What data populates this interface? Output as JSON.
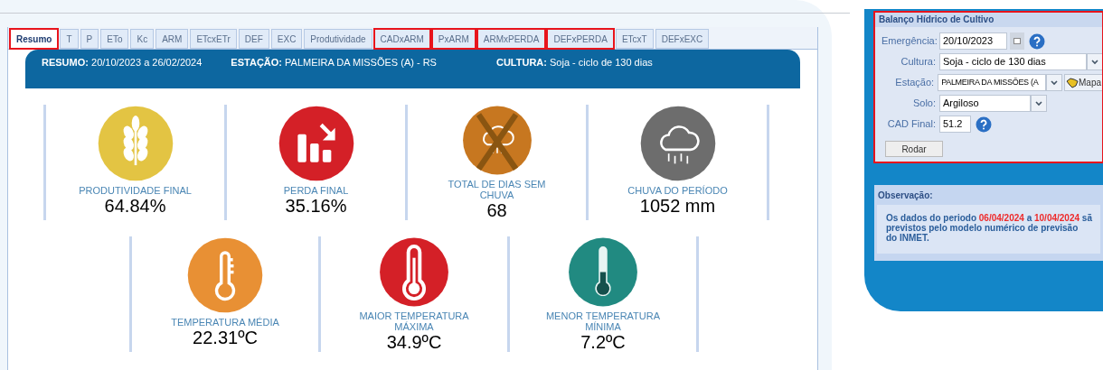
{
  "tabs": [
    {
      "label": "Resumo",
      "selected": true,
      "highlighted": true
    },
    {
      "label": "T",
      "selected": false,
      "highlighted": false
    },
    {
      "label": "P",
      "selected": false,
      "highlighted": false
    },
    {
      "label": "ETo",
      "selected": false,
      "highlighted": false
    },
    {
      "label": "Kc",
      "selected": false,
      "highlighted": false
    },
    {
      "label": "ARM",
      "selected": false,
      "highlighted": false
    },
    {
      "label": "ETcxETr",
      "selected": false,
      "highlighted": false
    },
    {
      "label": "DEF",
      "selected": false,
      "highlighted": false
    },
    {
      "label": "EXC",
      "selected": false,
      "highlighted": false
    },
    {
      "label": "Produtividade",
      "selected": false,
      "highlighted": false
    },
    {
      "label": "CADxARM",
      "selected": false,
      "highlighted": true
    },
    {
      "label": "PxARM",
      "selected": false,
      "highlighted": true
    },
    {
      "label": "ARMxPERDA",
      "selected": false,
      "highlighted": true
    },
    {
      "label": "DEFxPERDA",
      "selected": false,
      "highlighted": true
    },
    {
      "label": "ETcxT",
      "selected": false,
      "highlighted": false
    },
    {
      "label": "DEFxEXC",
      "selected": false,
      "highlighted": false
    }
  ],
  "header": [
    {
      "label": "RESUMO:",
      "value": "20/10/2023 a 26/02/2024"
    },
    {
      "label": "ESTAÇÃO:",
      "value": "PALMEIRA DA MISSÕES (A) - RS"
    },
    {
      "label": "CULTURA:",
      "value": "Soja - ciclo de 130 dias"
    }
  ],
  "cards_row_1": [
    {
      "kind": "wheat",
      "color": "#e3c443",
      "label": "PRODUTIVIDADE FINAL",
      "value": "64.84%"
    },
    {
      "kind": "loss",
      "color": "#d42027",
      "label": "PERDA FINAL",
      "value": "35.16%"
    },
    {
      "kind": "dry",
      "color": "#c77720",
      "label": "TOTAL DE DIAS SEM CHUVA",
      "value": "68"
    },
    {
      "kind": "rain",
      "color": "#6d6d6d",
      "label": "CHUVA DO PERÍODO",
      "value": "1052 mm"
    }
  ],
  "cards_row_2": [
    {
      "kind": "thermo-avg",
      "color": "#e89034",
      "label": "TEMPERATURA MÉDIA",
      "value": "22.31ºC"
    },
    {
      "kind": "thermo-max",
      "color": "#d42027",
      "label": "MAIOR TEMPERATURA MÁXIMA",
      "value": "34.9ºC"
    },
    {
      "kind": "thermo-min",
      "color": "#218a81",
      "label": "MENOR TEMPERATURA MÍNIMA",
      "value": "7.2ºC"
    }
  ],
  "form": {
    "title": "Balanço Hídrico de Cultivo",
    "highlighted": true,
    "fields": [
      {
        "kind": "date",
        "label": "Emergência:",
        "value": "20/10/2023"
      },
      {
        "kind": "select-wide",
        "label": "Cultura:",
        "value": "Soja - ciclo de 130 dias"
      },
      {
        "kind": "select-map",
        "label": "Estação:",
        "value": "PALMEIRA DA MISSÕES (A",
        "button": "Mapa"
      },
      {
        "kind": "select",
        "label": "Solo:",
        "value": "Argiloso"
      },
      {
        "kind": "number",
        "label": "CAD Final:",
        "value": "51.2"
      }
    ],
    "submit": "Rodar"
  },
  "note": {
    "title": "Observação:",
    "lines": [
      [
        {
          "kind": "plain",
          "text": "Os dados do periodo "
        },
        {
          "kind": "date",
          "text": "06/04/2024"
        },
        {
          "kind": "plain",
          "text": " a "
        },
        {
          "kind": "date",
          "text": "10/04/2024"
        },
        {
          "kind": "plain",
          "text": " sã"
        }
      ],
      [
        {
          "kind": "plain",
          "text": "previstos pelo modelo numérico de previsão"
        }
      ],
      [
        {
          "kind": "plain",
          "text": "do INMET."
        }
      ]
    ]
  }
}
